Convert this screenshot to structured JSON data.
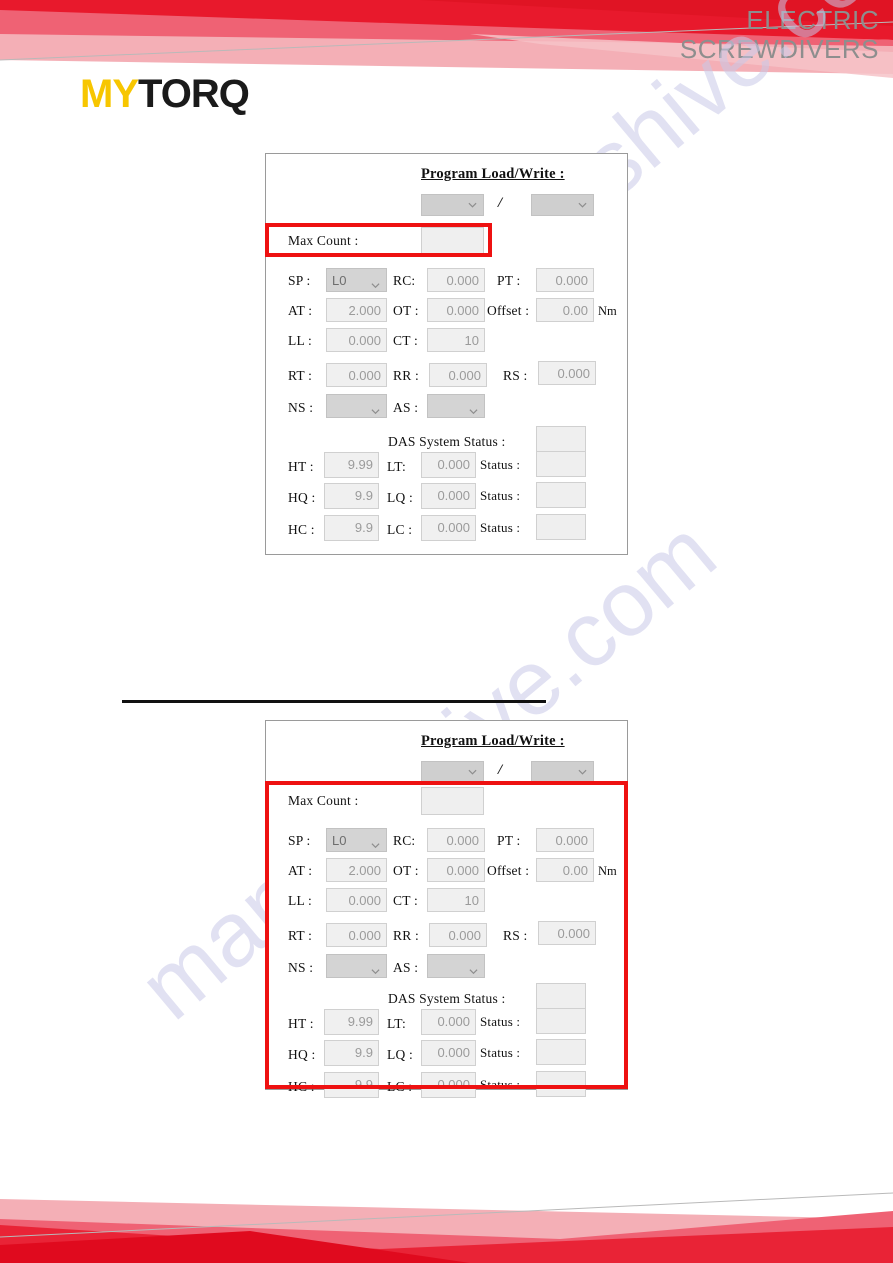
{
  "header": {
    "brand_my": "MY",
    "brand_torq": "TORQ",
    "subtitle_line1": "ELECTRIC",
    "subtitle_line2": "SCREWDIVERS",
    "accent_red": "#E8192C",
    "accent_red_light": "#EF6274",
    "accent_pink": "#F4AFB6",
    "brand_yellow": "#F7C600",
    "highlight_red": "#EE1111"
  },
  "watermark": {
    "text": "manualshive.com"
  },
  "panel": {
    "title": "Program Load/Write  :",
    "separator": "/",
    "program_select_value": "",
    "program_total_value": "",
    "max_count": {
      "label": "Max Count :",
      "value": ""
    },
    "unit": "Nm",
    "rows": [
      {
        "label_a": "SP :",
        "value_a": "L0",
        "type_a": "dropdown",
        "label_b": "RC:",
        "value_b": "0.000",
        "type_b": "field",
        "label_c": "PT :",
        "value_c": "0.000",
        "type_c": "field"
      },
      {
        "label_a": "AT :",
        "value_a": "2.000",
        "type_a": "field",
        "label_b": "OT :",
        "value_b": "0.000",
        "type_b": "field",
        "label_c": "Offset :",
        "value_c": "0.00",
        "type_c": "field"
      },
      {
        "label_a": "LL :",
        "value_a": "0.000",
        "type_a": "field",
        "label_b": "CT :",
        "value_b": "10",
        "type_b": "field",
        "label_c": "",
        "value_c": "",
        "type_c": "none"
      },
      {
        "label_a": "RT :",
        "value_a": "0.000",
        "type_a": "field",
        "label_b": "RR :",
        "value_b": "0.000",
        "type_b": "field",
        "label_c": "RS :",
        "value_c": "0.000",
        "type_c": "field"
      },
      {
        "label_a": "NS :",
        "value_a": "",
        "type_a": "dropdown",
        "label_b": "AS :",
        "value_b": "",
        "type_b": "dropdown",
        "label_c": "",
        "value_c": "",
        "type_c": "none"
      }
    ],
    "das": {
      "label": "DAS System Status :",
      "value": ""
    },
    "status_rows": [
      {
        "label_a": "HT :",
        "value_a": "9.99",
        "label_b": "LT:",
        "value_b": "0.000",
        "label_c": "Status :",
        "value_c": ""
      },
      {
        "label_a": "HQ :",
        "value_a": "9.9",
        "label_b": "LQ :",
        "value_b": "0.000",
        "label_c": "Status :",
        "value_c": ""
      },
      {
        "label_a": "HC :",
        "value_a": "9.9",
        "label_b": "LC :",
        "value_b": "0.000",
        "label_c": "Status :",
        "value_c": ""
      }
    ]
  }
}
